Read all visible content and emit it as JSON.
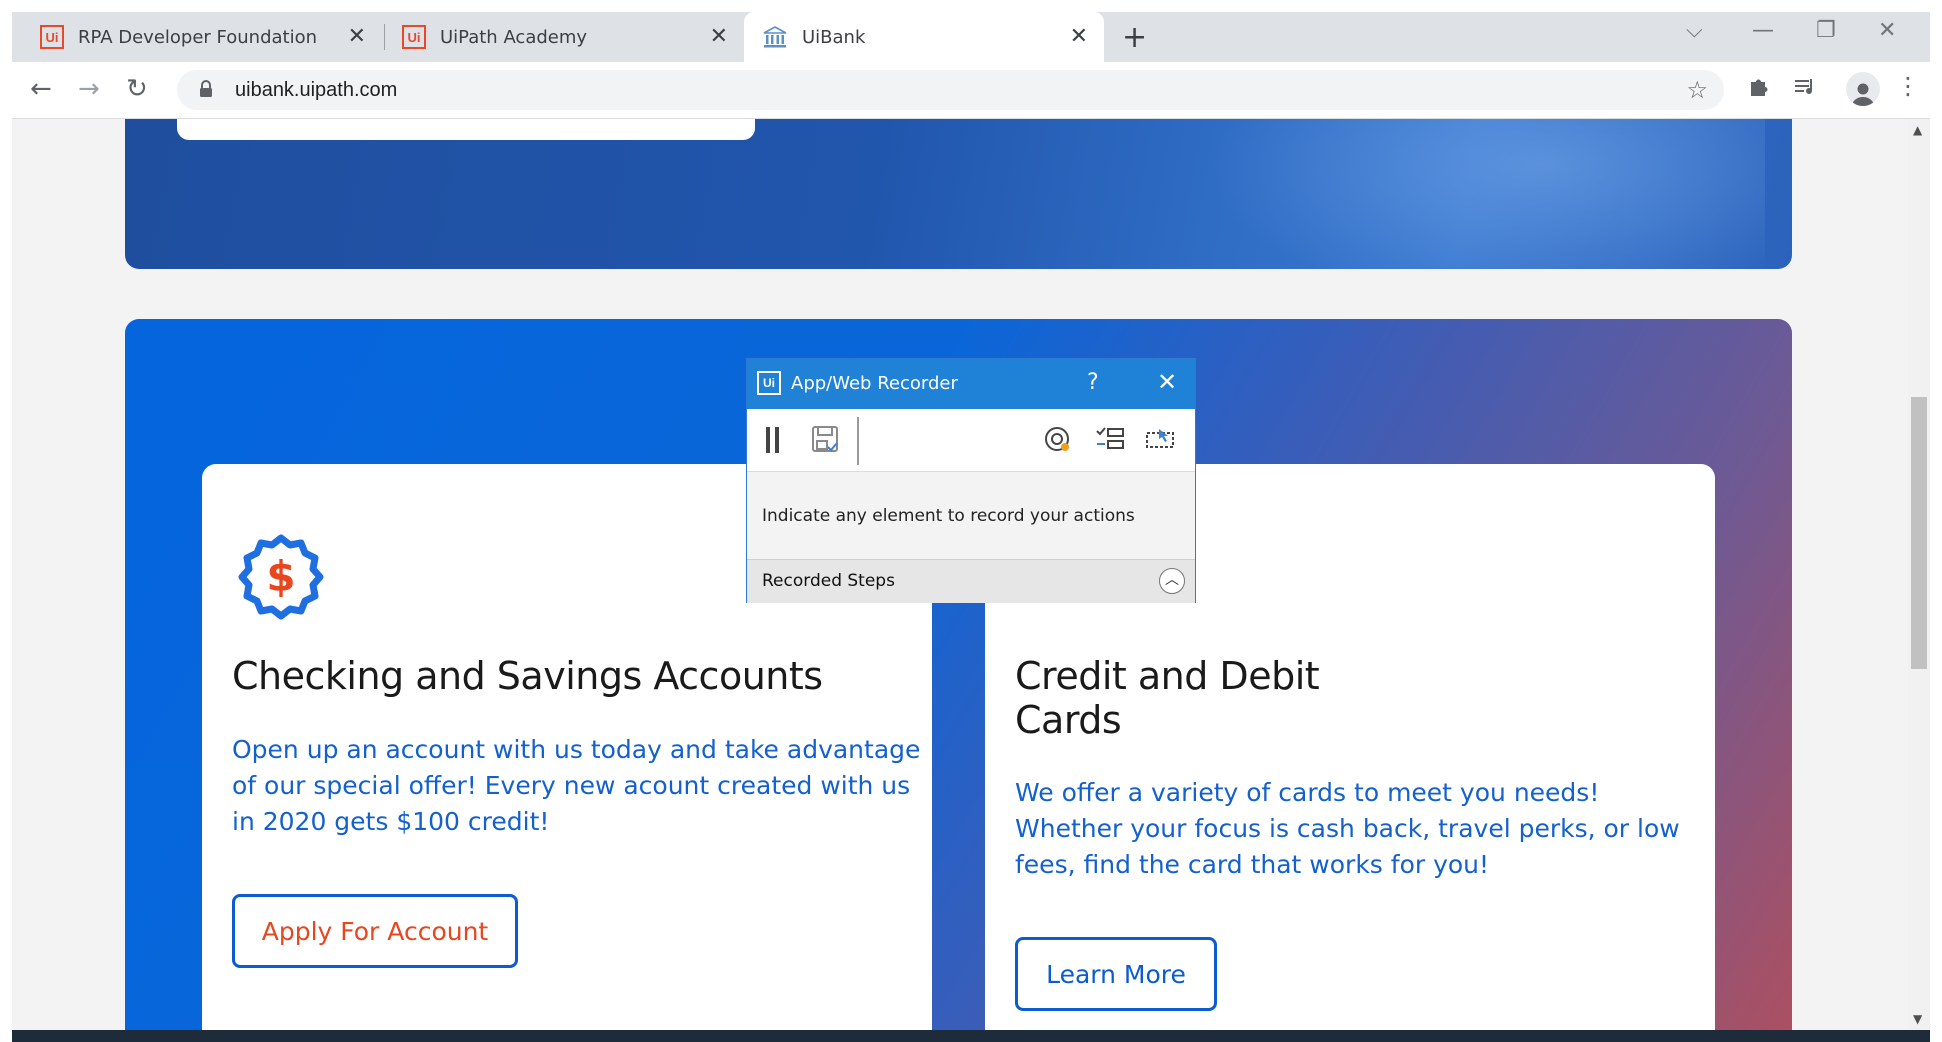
{
  "browser": {
    "tabs": [
      {
        "title": "RPA Developer Foundation",
        "icon": "uipath-logo-icon",
        "active": false
      },
      {
        "title": "UiPath Academy",
        "icon": "uipath-logo-icon",
        "active": false
      },
      {
        "title": "UiBank",
        "icon": "bank-icon",
        "active": true
      }
    ],
    "tab_icon_text": "Ui",
    "url": "uibank.uipath.com"
  },
  "cards": {
    "checking": {
      "title": "Checking and Savings Accounts",
      "description": "Open up an account with us today and take advantage of our special offer! Every new acount created with us in 2020 gets $100 credit!",
      "button": "Apply For Account",
      "icon": "dollar-badge-icon",
      "button_color": "#e8461f"
    },
    "cards": {
      "title": "Credit and Debit Cards",
      "description": "We offer a variety of cards to meet you needs! Whether your focus is cash back, travel perks, or low fees, find the card that works for you!",
      "button": "Learn More",
      "button_color": "#0b5cd0"
    }
  },
  "recorder": {
    "title": "App/Web Recorder",
    "logo_text": "Ui",
    "help": "?",
    "message": "Indicate any element to record your actions",
    "steps_label": "Recorded Steps"
  },
  "colors": {
    "accent": "#1f82d6",
    "text_blue": "#1360cf",
    "brand_orange": "#e8461f"
  }
}
